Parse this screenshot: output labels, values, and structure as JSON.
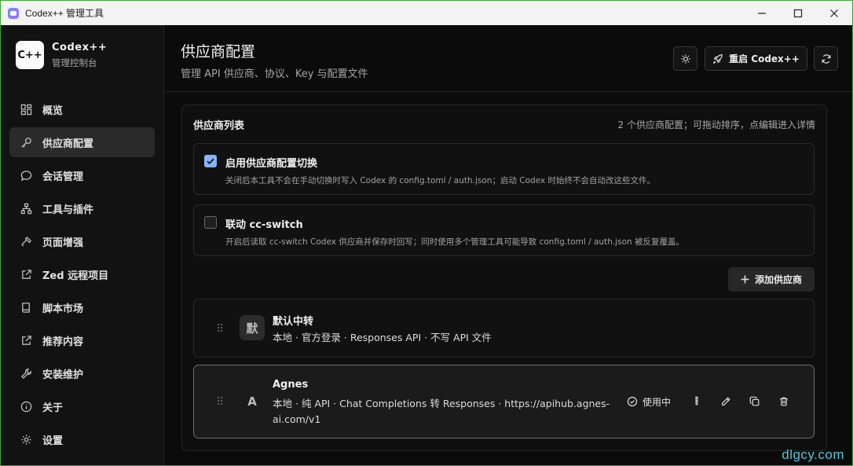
{
  "window": {
    "title": "Codex++ 管理工具"
  },
  "brand": {
    "logo": "C++",
    "name": "Codex++",
    "subtitle": "管理控制台"
  },
  "sidebar": {
    "items": [
      {
        "label": "概览",
        "icon": "grid-icon",
        "active": false
      },
      {
        "label": "供应商配置",
        "icon": "key-icon",
        "active": true
      },
      {
        "label": "会话管理",
        "icon": "chat-icon",
        "active": false
      },
      {
        "label": "工具与插件",
        "icon": "network-icon",
        "active": false
      },
      {
        "label": "页面增强",
        "icon": "hammer-icon",
        "active": false
      },
      {
        "label": "Zed 远程项目",
        "icon": "external-link-icon",
        "active": false
      },
      {
        "label": "脚本市场",
        "icon": "book-icon",
        "active": false
      },
      {
        "label": "推荐内容",
        "icon": "external-link-icon",
        "active": false
      },
      {
        "label": "安装维护",
        "icon": "wrench-icon",
        "active": false
      },
      {
        "label": "关于",
        "icon": "info-icon",
        "active": false
      },
      {
        "label": "设置",
        "icon": "gear-icon",
        "active": false
      }
    ]
  },
  "header": {
    "title": "供应商配置",
    "subtitle": "管理 API 供应商、协议、Key 与配置文件",
    "restart_label": "重启 Codex++"
  },
  "panel": {
    "title": "供应商列表",
    "hint": "2 个供应商配置；可拖动排序，点编辑进入详情",
    "toggles": [
      {
        "title": "启用供应商配置切换",
        "description": "关闭后本工具不会在手动切换时写入 Codex 的 config.toml / auth.json；启动 Codex 时始终不会自动改这些文件。",
        "checked": true
      },
      {
        "title": "联动 cc-switch",
        "description": "开启后读取 cc-switch Codex 供应商并保存时回写；同时使用多个管理工具可能导致 config.toml / auth.json 被反复覆盖。",
        "checked": false
      }
    ],
    "add_label": "添加供应商",
    "providers": [
      {
        "avatar": "默",
        "name": "默认中转",
        "meta": "本地 · 官方登录 · Responses API · 不写 API 文件",
        "active": false
      },
      {
        "avatar": "A",
        "name": "Agnes",
        "meta_line1": "本地 · 纯 API · Chat Completions 转 Responses · https://apihub.agnes-",
        "meta_line2": "ai.com/v1",
        "active": true,
        "status": "使用中"
      }
    ]
  },
  "watermark": "dlgcy.com",
  "colors": {
    "checkbox_on": "#8ab4f8",
    "background": "#0b0b0b",
    "frame": "#3aa832"
  }
}
